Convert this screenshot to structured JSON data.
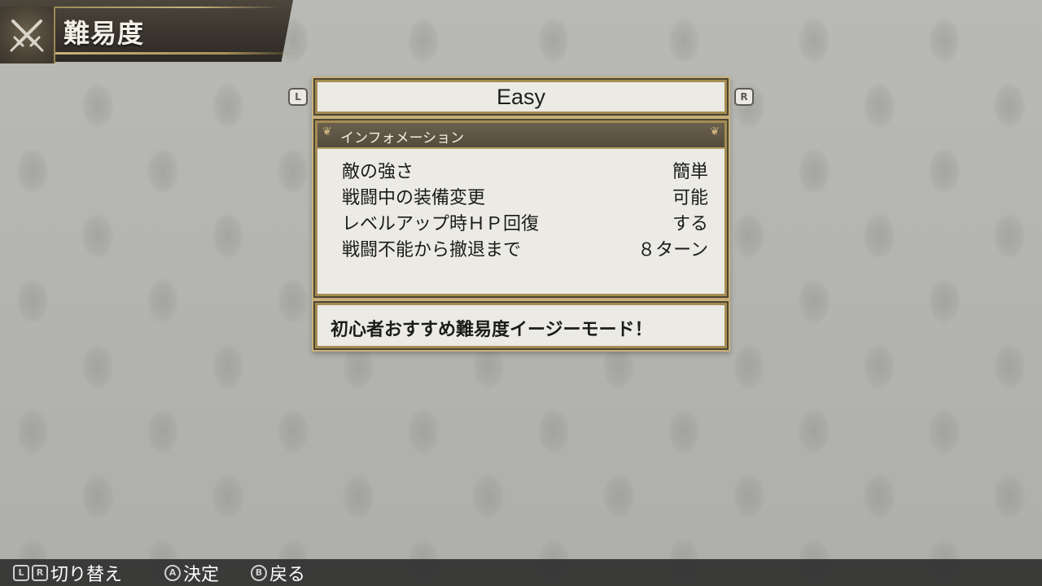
{
  "header": {
    "title": "難易度",
    "emblem_icon": "crossed-swords-icon"
  },
  "difficulty": {
    "value": "Easy",
    "prev_button": "L",
    "next_button": "R"
  },
  "info": {
    "title": "インフォメーション",
    "rows": [
      {
        "label": "敵の強さ",
        "value": "簡単"
      },
      {
        "label": "戦闘中の装備変更",
        "value": "可能"
      },
      {
        "label": "レベルアップ時ＨＰ回復",
        "value": "する"
      },
      {
        "label": "戦闘不能から撤退まで",
        "value": "８ターン"
      }
    ]
  },
  "description": "初心者おすすめ難易度イージーモード！",
  "controls": {
    "switch": {
      "keys": [
        "L",
        "R"
      ],
      "label": "切り替え"
    },
    "confirm": {
      "key": "A",
      "label": "決定"
    },
    "back": {
      "key": "B",
      "label": "戻る"
    }
  },
  "colors": {
    "gold": "#a48c52",
    "panel": "#ebeae4",
    "header_band": "#3a352e",
    "background": "#b3b3af"
  }
}
